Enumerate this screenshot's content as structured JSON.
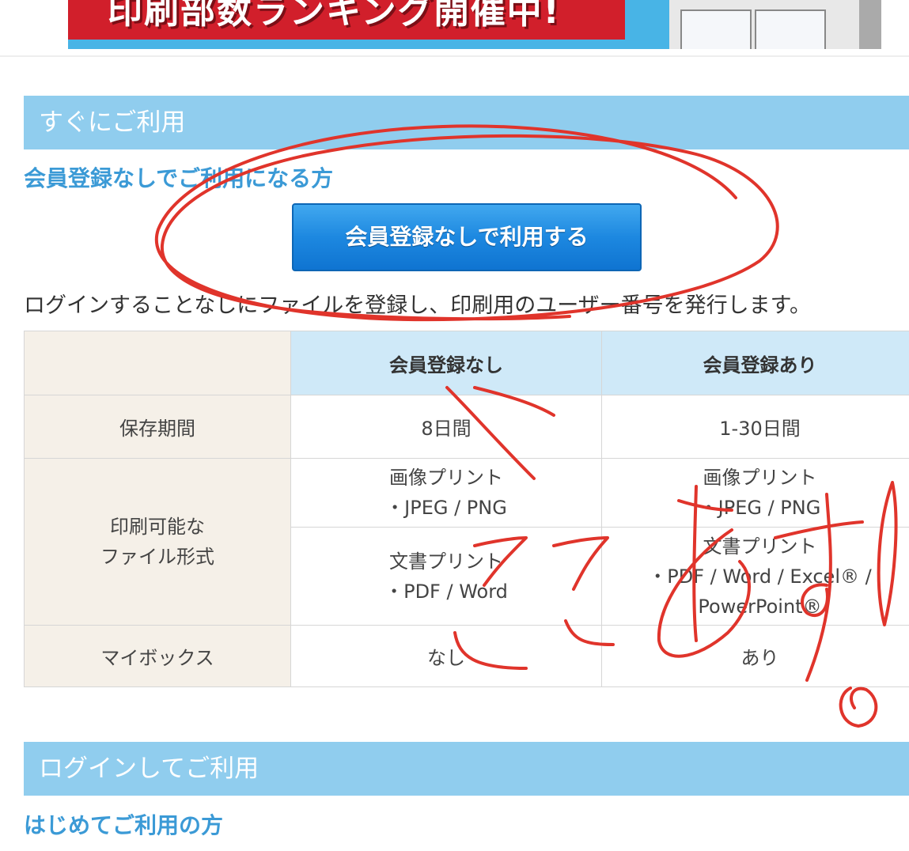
{
  "banner": {
    "title": "印刷部数ランキング開催中!"
  },
  "section1": {
    "heading": "すぐにご利用",
    "subheading": "会員登録なしでご利用になる方",
    "button_label": "会員登録なしで利用する",
    "description": "ログインすることなしにファイルを登録し、印刷用のユーザー番号を発行します。"
  },
  "table": {
    "headers": [
      "会員登録なし",
      "会員登録あり"
    ],
    "rows": {
      "storage": {
        "label": "保存期間",
        "no_member": "8日間",
        "member": "1-30日間"
      },
      "formats": {
        "label_line1": "印刷可能な",
        "label_line2": "ファイル形式",
        "image": {
          "no_member_line1": "画像プリント",
          "no_member_line2": "・JPEG / PNG",
          "member_line1": "画像プリント",
          "member_line2": "・JPEG / PNG"
        },
        "document": {
          "no_member_line1": "文書プリント",
          "no_member_line2": "・PDF / Word",
          "member_line1": "文書プリント",
          "member_line2": "・PDF / Word / Excel® /",
          "member_line3": "PowerPoint®"
        }
      },
      "mybox": {
        "label": "マイボックス",
        "no_member": "なし",
        "member": "あり"
      }
    }
  },
  "section2": {
    "heading": "ログインしてご利用",
    "subheading": "はじめてご利用の方"
  },
  "annotation": {
    "handwritten_text": "ここおすすめ!",
    "stroke_color": "#e0342b"
  }
}
